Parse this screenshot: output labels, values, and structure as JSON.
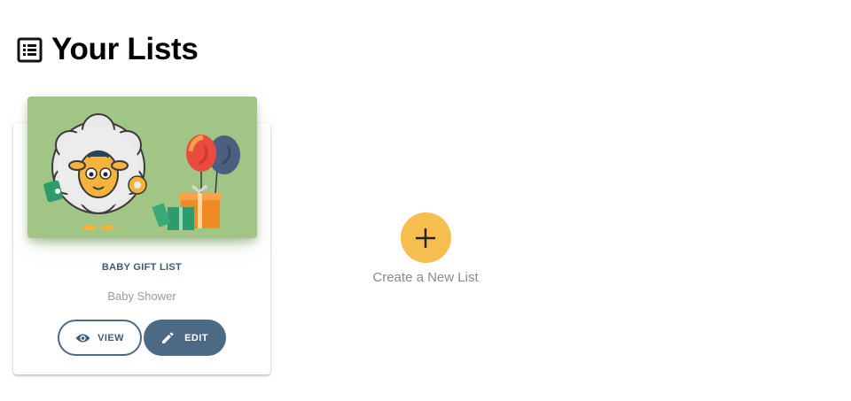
{
  "header": {
    "title": "Your Lists",
    "icon": "list-icon"
  },
  "lists": [
    {
      "title": "BABY GIFT LIST",
      "subtitle": "Baby Shower",
      "image": "sheep-balloons-gift-illustration",
      "image_bg": "#a1c584",
      "view_label": "VIEW",
      "edit_label": "EDIT"
    }
  ],
  "create": {
    "label": "Create a New List",
    "icon": "plus-icon",
    "color": "#f6be4f"
  },
  "colors": {
    "primary": "#4d6a85",
    "accent": "#f6be4f"
  }
}
